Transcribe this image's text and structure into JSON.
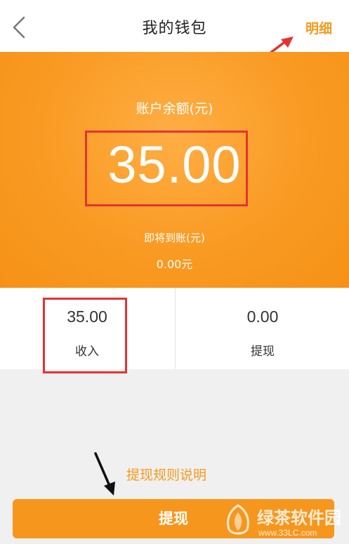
{
  "header": {
    "title": "我的钱包",
    "detail_link": "明细"
  },
  "balance": {
    "label": "账户余额(元)",
    "value": "35.00",
    "pending_label": "即将到账(元)",
    "pending_value": "0.00元"
  },
  "stats": [
    {
      "value": "35.00",
      "label": "收入"
    },
    {
      "value": "0.00",
      "label": "提现"
    }
  ],
  "rules_link": "提现规则说明",
  "withdraw_button": "提现",
  "watermark": {
    "text": "绿茶软件园",
    "url": "www.33LC.com"
  },
  "colors": {
    "accent": "#f7961c",
    "annotation": "#e53332"
  }
}
